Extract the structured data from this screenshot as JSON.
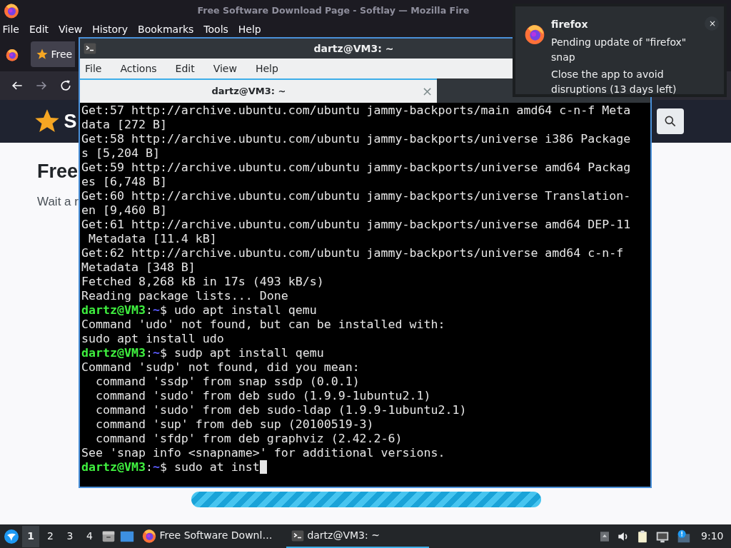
{
  "browser": {
    "title": "Free Software Download Page - Softlay — Mozilla Fire",
    "menu": [
      "File",
      "Edit",
      "View",
      "History",
      "Bookmarks",
      "Tools",
      "Help"
    ],
    "tab": {
      "label": "Free",
      "selected": true
    },
    "page": {
      "site_name": "S",
      "heading": "Free",
      "text": "Wait a r",
      "progress": {
        "level": 1
      }
    }
  },
  "terminal": {
    "title": "dartz@VM3: ~",
    "menu": [
      "File",
      "Actions",
      "Edit",
      "View",
      "Help"
    ],
    "tabs": [
      {
        "label": "dartz@VM3: ~",
        "selected": true,
        "close": "×"
      }
    ],
    "lines": [
      {
        "kind": "output",
        "text": "Get:57 http://archive.ubuntu.com/ubuntu jammy-backports/main amd64 c-n-f Meta"
      },
      {
        "kind": "output",
        "text": "data [272 B]"
      },
      {
        "kind": "output",
        "text": "Get:58 http://archive.ubuntu.com/ubuntu jammy-backports/universe i386 Package"
      },
      {
        "kind": "output",
        "text": "s [5,204 B]"
      },
      {
        "kind": "output",
        "text": "Get:59 http://archive.ubuntu.com/ubuntu jammy-backports/universe amd64 Packag"
      },
      {
        "kind": "output",
        "text": "es [6,748 B]"
      },
      {
        "kind": "output",
        "text": "Get:60 http://archive.ubuntu.com/ubuntu jammy-backports/universe Translation-"
      },
      {
        "kind": "output",
        "text": "en [9,460 B]"
      },
      {
        "kind": "output",
        "text": "Get:61 http://archive.ubuntu.com/ubuntu jammy-backports/universe amd64 DEP-11"
      },
      {
        "kind": "output",
        "text": " Metadata [11.4 kB]"
      },
      {
        "kind": "output",
        "text": "Get:62 http://archive.ubuntu.com/ubuntu jammy-backports/universe amd64 c-n-f"
      },
      {
        "kind": "output",
        "text": "Metadata [348 B]"
      },
      {
        "kind": "output",
        "text": "Fetched 8,268 kB in 17s (493 kB/s)"
      },
      {
        "kind": "output",
        "text": "Reading package lists... Done"
      },
      {
        "kind": "prompt",
        "user": "dartz@VM3",
        "sep": ":",
        "path": "~",
        "symbol": "$",
        "command": "udo apt install qemu",
        "cursor": false
      },
      {
        "kind": "output",
        "text": "Command 'udo' not found, but can be installed with:"
      },
      {
        "kind": "output",
        "text": "sudo apt install udo"
      },
      {
        "kind": "prompt",
        "user": "dartz@VM3",
        "sep": ":",
        "path": "~",
        "symbol": "$",
        "command": "sudp apt install qemu",
        "cursor": false
      },
      {
        "kind": "output",
        "text": "Command 'sudp' not found, did you mean:"
      },
      {
        "kind": "output",
        "text": "  command 'ssdp' from snap ssdp (0.0.1)"
      },
      {
        "kind": "output",
        "text": "  command 'sudo' from deb sudo (1.9.9-1ubuntu2.1)"
      },
      {
        "kind": "output",
        "text": "  command 'sudo' from deb sudo-ldap (1.9.9-1ubuntu2.1)"
      },
      {
        "kind": "output",
        "text": "  command 'sup' from deb sup (20100519-3)"
      },
      {
        "kind": "output",
        "text": "  command 'sfdp' from deb graphviz (2.42.2-6)"
      },
      {
        "kind": "output",
        "text": "See 'snap info <snapname>' for additional versions."
      },
      {
        "kind": "prompt",
        "user": "dartz@VM3",
        "sep": ":",
        "path": "~",
        "symbol": "$",
        "command": "sudo at inst",
        "cursor": true
      }
    ]
  },
  "notification": {
    "app": "firefox",
    "summary": "Pending update of \"firefox\" snap",
    "body": "Close the app to avoid disruptions (13 days left)",
    "close": "×"
  },
  "taskbar": {
    "workspaces": [
      {
        "label": "1",
        "selected": true
      },
      {
        "label": "2",
        "selected": false
      },
      {
        "label": "3",
        "selected": false
      },
      {
        "label": "4",
        "selected": false
      }
    ],
    "tasks": [
      {
        "kind": "browser",
        "label": "Free Software Downl…",
        "selected": false
      },
      {
        "kind": "terminal",
        "label": "dartz@VM3: ~",
        "selected": true
      }
    ],
    "clock": "9:10"
  }
}
